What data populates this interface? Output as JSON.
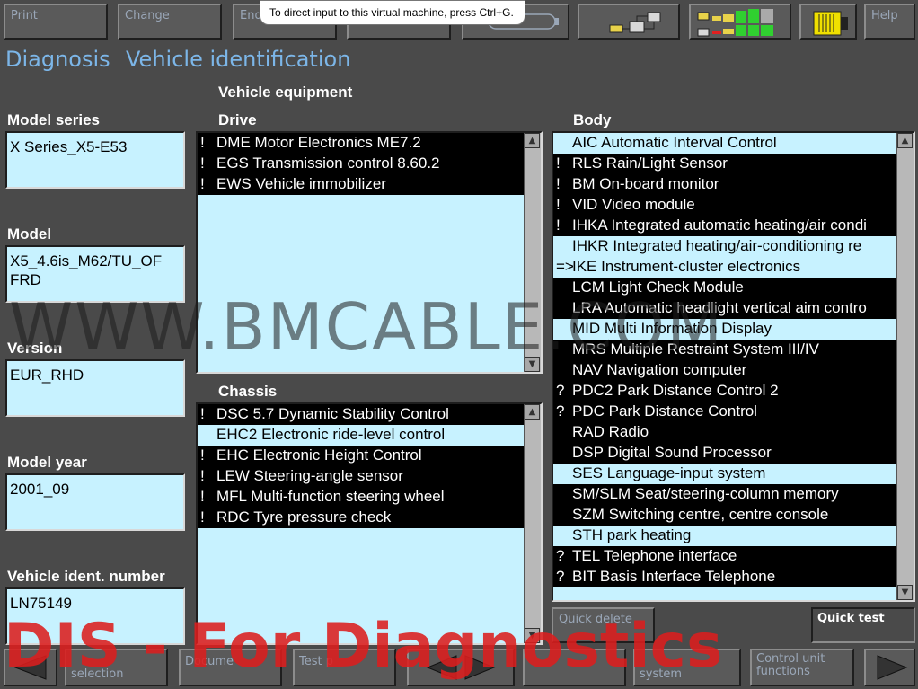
{
  "toolbar": {
    "print_label": "Print",
    "change_label": "Change",
    "end_label": "End",
    "help_label": "Help"
  },
  "tooltip": "To direct input to this virtual machine, press Ctrl+G.",
  "header": {
    "diagnosis": "Diagnosis",
    "vehicle_identification": "Vehicle identification"
  },
  "vehicle_equipment_label": "Vehicle equipment",
  "fields": {
    "model_series_label": "Model series",
    "model_series_value": "X Series_X5-E53",
    "model_label": "Model",
    "model_value": "X5_4.6is_M62/TU_OF\nFRD",
    "version_label": "Version",
    "version_value": "EUR_RHD",
    "model_year_label": "Model year",
    "model_year_value": "2001_09",
    "vin_label": "Vehicle ident. number",
    "vin_value": "LN75149"
  },
  "drive": {
    "label": "Drive",
    "items": [
      {
        "flag": "!",
        "text": "DME Motor Electronics ME7.2",
        "selected": true
      },
      {
        "flag": "!",
        "text": "EGS Transmission control 8.60.2",
        "selected": true
      },
      {
        "flag": "!",
        "text": "EWS Vehicle immobilizer",
        "selected": true
      }
    ]
  },
  "chassis": {
    "label": "Chassis",
    "items": [
      {
        "flag": "!",
        "text": "DSC 5.7 Dynamic Stability Control",
        "selected": true
      },
      {
        "flag": "",
        "text": "EHC2 Electronic ride-level control",
        "selected": false
      },
      {
        "flag": "!",
        "text": "EHC Electronic Height Control",
        "selected": true
      },
      {
        "flag": "!",
        "text": "LEW Steering-angle sensor",
        "selected": true
      },
      {
        "flag": "!",
        "text": "MFL Multi-function steering wheel",
        "selected": true
      },
      {
        "flag": "!",
        "text": "RDC Tyre pressure check",
        "selected": true
      }
    ]
  },
  "body": {
    "label": "Body",
    "items": [
      {
        "flag": "",
        "text": "AIC Automatic Interval Control",
        "selected": false
      },
      {
        "flag": "!",
        "text": "RLS Rain/Light Sensor",
        "selected": true
      },
      {
        "flag": "!",
        "text": "BM On-board monitor",
        "selected": true
      },
      {
        "flag": "!",
        "text": "VID Video module",
        "selected": true
      },
      {
        "flag": "!",
        "text": "IHKA Integrated automatic heating/air condi",
        "selected": true
      },
      {
        "flag": "",
        "text": "IHKR Integrated heating/air-conditioning re",
        "selected": false
      },
      {
        "flag": "=>",
        "text": "IKE Instrument-cluster electronics",
        "selected": false
      },
      {
        "flag": "",
        "text": "LCM Light Check Module",
        "selected": true
      },
      {
        "flag": "",
        "text": "LRA Automatic headlight vertical aim contro",
        "selected": true
      },
      {
        "flag": "",
        "text": "MID Multi Information Display",
        "selected": false
      },
      {
        "flag": "",
        "text": "MRS Multiple Restraint System III/IV",
        "selected": true
      },
      {
        "flag": "",
        "text": "NAV Navigation computer",
        "selected": true
      },
      {
        "flag": "?",
        "text": "PDC2 Park Distance Control 2",
        "selected": true
      },
      {
        "flag": "?",
        "text": "PDC Park Distance Control",
        "selected": true
      },
      {
        "flag": "",
        "text": "RAD Radio",
        "selected": true
      },
      {
        "flag": "",
        "text": "DSP Digital Sound Processor",
        "selected": true
      },
      {
        "flag": "",
        "text": "SES Language-input system",
        "selected": false
      },
      {
        "flag": "",
        "text": "SM/SLM Seat/steering-column memory",
        "selected": true
      },
      {
        "flag": "",
        "text": "SZM Switching centre, centre console",
        "selected": true
      },
      {
        "flag": "",
        "text": "STH park heating",
        "selected": false
      },
      {
        "flag": "?",
        "text": "TEL Telephone interface",
        "selected": true
      },
      {
        "flag": "?",
        "text": "BIT Basis Interface Telephone",
        "selected": true
      }
    ]
  },
  "actions": {
    "quick_delete": "Quick delete",
    "quick_test": "Quick test"
  },
  "bottom": {
    "selection": "selection",
    "documents": "Docume",
    "test_plan": "Test p",
    "system": "system",
    "control_unit_functions": "Control unit functions"
  },
  "watermarks": {
    "site": "WWW.BMCABLE.COM",
    "dis": "DIS - For Diagnostics"
  },
  "colors": {
    "background": "#4a4a4a",
    "list_bg": "#c7f2ff",
    "header_text": "#7cb6e8",
    "selected_row": "#000000"
  }
}
